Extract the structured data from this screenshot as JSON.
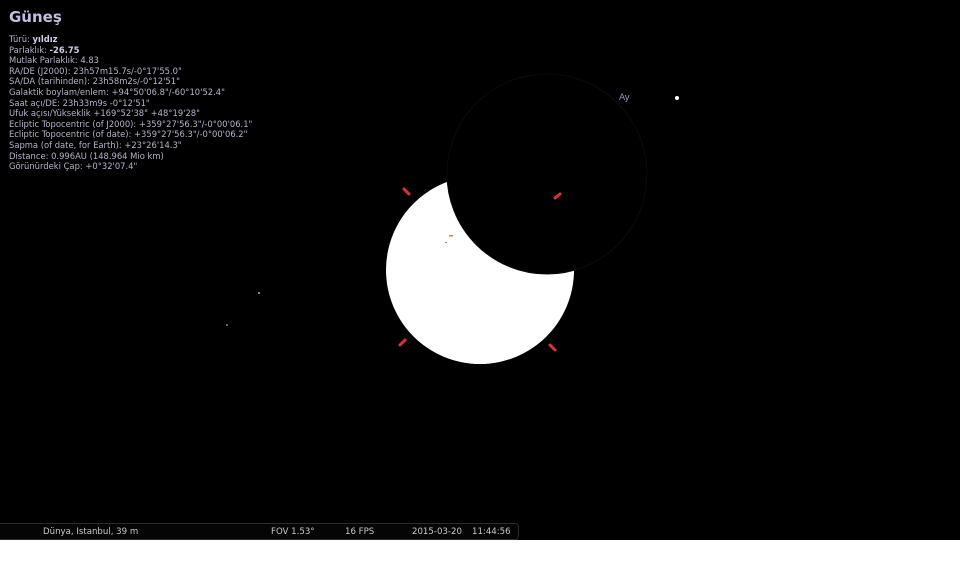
{
  "object": {
    "title": "Güneş",
    "type_label": "Türü: ",
    "type_value": "yıldız",
    "magnitude_label": "Parlaklık: ",
    "magnitude_value": "-26.75",
    "lines": [
      "Mutlak Parlaklık: 4.83",
      "RA/DE (J2000): 23h57m15.7s/-0°17'55.0\"",
      "SA/DA (tarihinden): 23h58m2s/-0°12'51\"",
      "Galaktik boylam/enlem: +94°50'06.8\"/-60°10'52.4\"",
      "Saat açı/DE: 23h33m9s -0°12'51\"",
      "Ufuk açısı/Yükseklik +169°52'38\" +48°19'28\"",
      "Ecliptic Topocentric (of J2000): +359°27'56.3\"/-0°00'06.1\"",
      "Ecliptic Topocentric (of date): +359°27'56.3\"/-0°00'06.2\"",
      "Sapma (of date, for Earth): +23°26'14.3\"",
      "Distance: 0.996AU (148.964 Mio km)",
      "Görünürdeki Çap: +0°32'07.4\""
    ]
  },
  "sky": {
    "moon_label": "Ay",
    "sun_color": "#ffffff",
    "background_color": "#000000",
    "marker_color": "#e03030"
  },
  "status_bar": {
    "location": "Dünya, Istanbul, 39 m",
    "fov": "FOV 1.53°",
    "fps": "16 FPS",
    "date": "2015-03-20",
    "time": "11:44:56"
  }
}
